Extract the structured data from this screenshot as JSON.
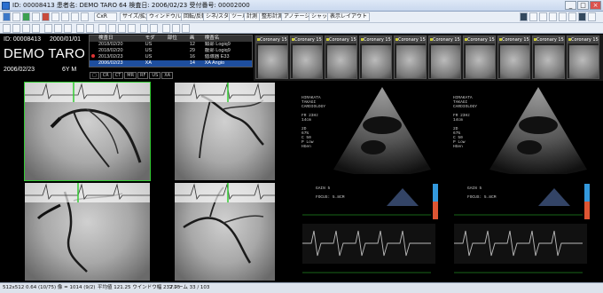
{
  "window": {
    "title": "ID: 00008413 患者名: DEMO TARO 64 検査日: 2006/02/23 受付番号: 00002000"
  },
  "toolbar": {
    "mode_select": "CxR",
    "tabs": [
      "サイズ/拡大",
      "ウィンドウ/レベル",
      "回転/反転",
      "シネ/スタック",
      "ツール",
      "計測",
      "整形計測",
      "アノテーション",
      "シャッタ",
      "表示レイアウト"
    ]
  },
  "patient": {
    "id": "ID: 00008413",
    "dob": "2000/01/01",
    "name": "DEMO TARO",
    "study_date": "2006/02/23",
    "age_sex": "6Y M"
  },
  "study_list": {
    "headers": [
      "検査日",
      "モダ",
      "部位",
      "画",
      "検査名"
    ],
    "rows": [
      [
        "2018/02/20",
        "US",
        "",
        "12",
        "頸部 Logiq9"
      ],
      [
        "2018/02/20",
        "US",
        "",
        "29",
        "腹部 Logiq9"
      ],
      [
        "2013/02/23",
        "US",
        "",
        "16",
        "循環器 E33"
      ],
      [
        "2006/02/23",
        "XA",
        "",
        "14",
        "XA Angio"
      ]
    ]
  },
  "modality_filter": [
    "CR",
    "CT",
    "MR",
    "RF",
    "US",
    "XA"
  ],
  "thumbnails": [
    "Coronary 15",
    "Coronary 15",
    "Coronary 15",
    "Coronary 15",
    "Coronary 15",
    "Coronary 15",
    "Coronary 15",
    "Coronary 15",
    "Coronary 15",
    "Coronary 15"
  ],
  "echo": {
    "left_info": "HIRAKATA\nTAKAGI\nCARDIOLOGY\n\nFR 23Hz\n14cm\n\n2D\n67%\nC 50\nP Low\nHGen",
    "right_info": "HIRAKATA\nTAKAGI\nCARDIOLOGY\n\nFR 23Hz\n14cm\n\n2D\n67%\nC 50\nP Low\nHGen",
    "dop_left": "GAIN 5\n\nFOCUS: 5.8CM",
    "dop_right": "GAIN 5\n\nFOCUS: 5.8CM"
  },
  "statusbar": {
    "left": "512x512 0.64 (10/75) 像 = 1014 (9/2)",
    "center": "平均値 121.25 ウインドウ幅 232.75",
    "right": "フレーム 33 / 103"
  },
  "colors": {
    "accent": "#3c3",
    "selection": "#1e4e9e"
  }
}
